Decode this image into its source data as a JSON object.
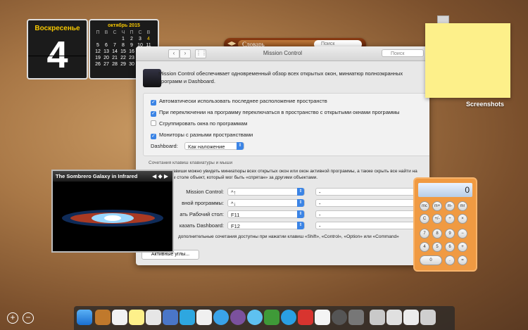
{
  "calendar": {
    "weekday": "Воскресенье",
    "day": "4",
    "month_title": "октябрь 2015",
    "weekdays": [
      "П",
      "В",
      "С",
      "Ч",
      "П",
      "С",
      "В"
    ],
    "days": [
      "",
      "",
      "",
      "1",
      "2",
      "3",
      "4",
      "5",
      "6",
      "7",
      "8",
      "9",
      "10",
      "11",
      "12",
      "13",
      "14",
      "15",
      "16",
      "17",
      "18",
      "19",
      "20",
      "21",
      "22",
      "23",
      "24",
      "25",
      "26",
      "27",
      "28",
      "29",
      "30",
      "31",
      ""
    ]
  },
  "dictionary": {
    "source": "Словарь",
    "search_placeholder": "Поиск"
  },
  "prefs": {
    "title": "Mission Control",
    "search_placeholder": "Поиск",
    "description": "Mission Control обеспечивает одновременный обзор всех открытых окон, миниатюр полноэкранных программ и Dashboard.",
    "checkboxes": [
      {
        "label": "Автоматически использовать последнее расположение пространств",
        "checked": true
      },
      {
        "label": "При переключении на программу переключаться в пространство с открытыми окнами программы",
        "checked": true
      },
      {
        "label": "Сгруппировать окна по программам",
        "checked": false
      },
      {
        "label": "Мониторы с разными пространствами",
        "checked": true
      }
    ],
    "dashboard_label": "Dashboard:",
    "dashboard_value": "Как наложение",
    "section_title": "Сочетания клавиш клавиатуры и мыши",
    "section_desc": "этим клавиши можно увидеть миниатюры всех открытых окон или окон активной программы, а также скрыть все найти на Рабочем столе объект, который мог быть «спрятан» за другими объектами.",
    "rows": [
      {
        "label": "Mission Control:",
        "key": "^↑",
        "mouse": "-"
      },
      {
        "label": "вной программы:",
        "key": "^↓",
        "mouse": "-"
      },
      {
        "label": "ать Рабочий стол:",
        "key": "F11",
        "mouse": "-"
      },
      {
        "label": "казать Dashboard:",
        "key": "F12",
        "mouse": "-"
      }
    ],
    "extra_note": "дополнительные сочетания доступны при нажатии клавиш «Shift», «Control», «Option» или «Command»",
    "corners_button": "Активные углы..."
  },
  "desktop": {
    "screenshots_label": "Screenshots"
  },
  "galaxy": {
    "title": "The Sombrero Galaxy in Infrared"
  },
  "calculator": {
    "display": "0",
    "keys": [
      "mc",
      "m+",
      "m-",
      "mr",
      "C",
      "+/-",
      "÷",
      "×",
      "7",
      "8",
      "9",
      "−",
      "4",
      "5",
      "6",
      "+",
      "1",
      "2",
      "3",
      "=",
      "0",
      ".",
      ""
    ]
  },
  "controls": {
    "add": "+",
    "remove": "−"
  }
}
